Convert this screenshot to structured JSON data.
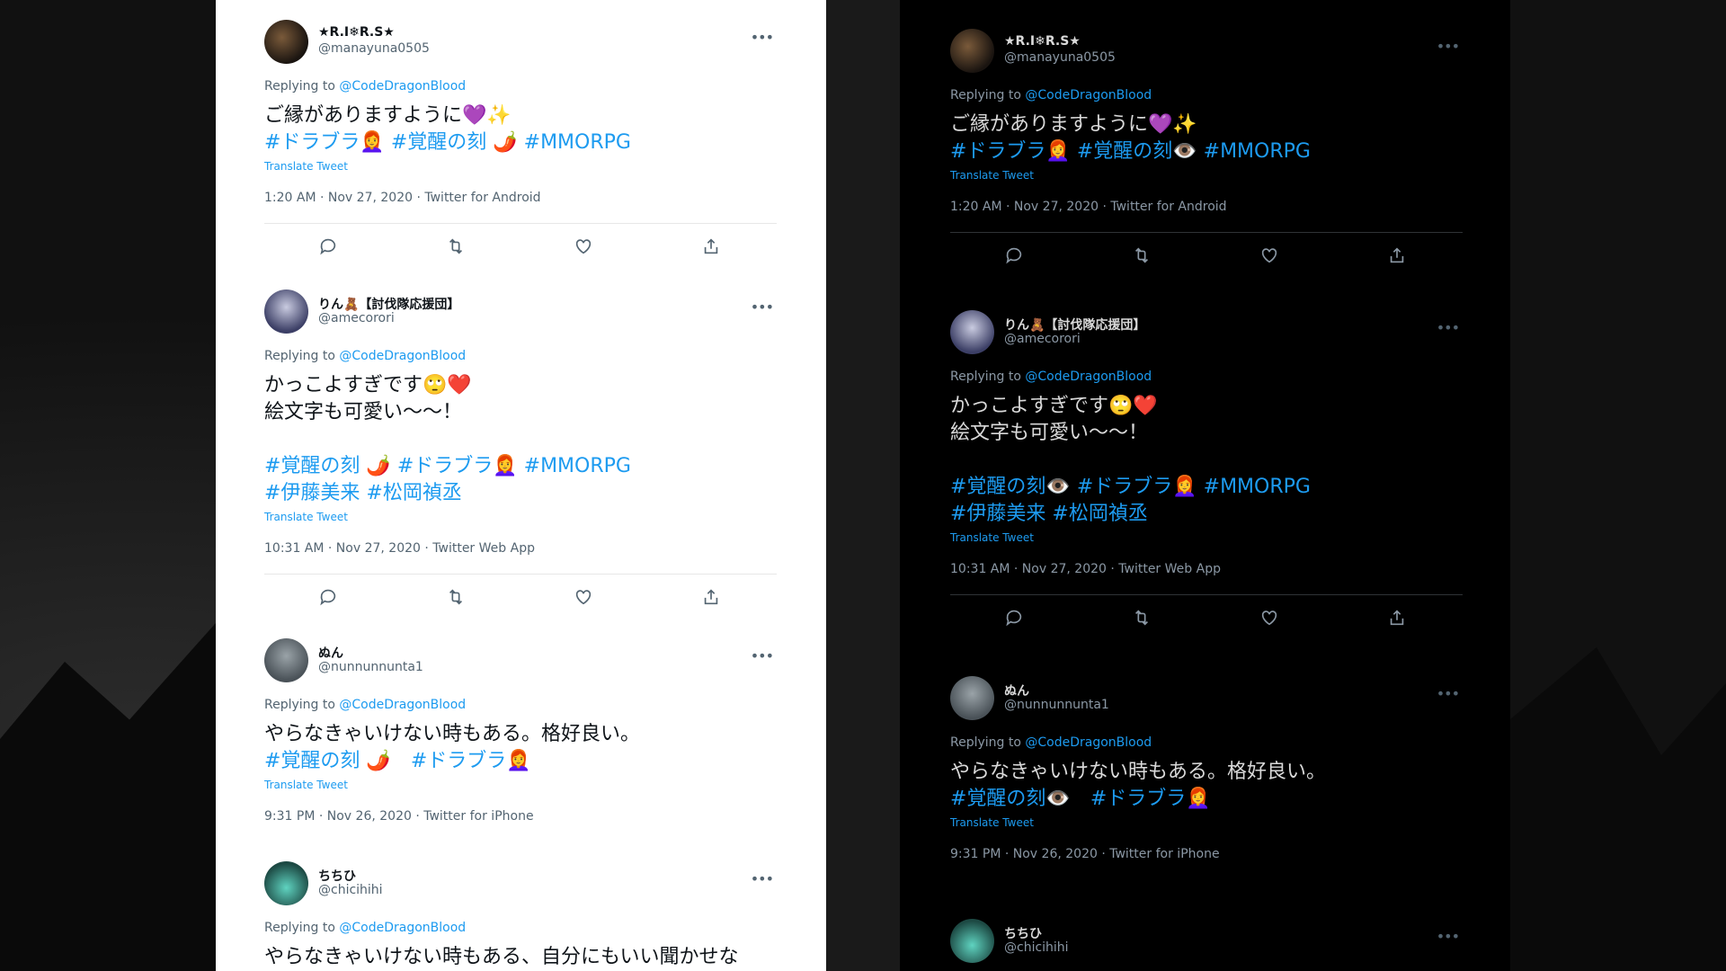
{
  "tweets": [
    {
      "name": "★R.I❄R.S★",
      "handle": "@manayuna0505",
      "replying_prefix": "Replying to ",
      "replying_to": "@CodeDragonBlood",
      "body": "ご縁がありますように💜✨",
      "hashtags": [
        "#ドラブラ👩‍🦰 #覚醒の刻 🌶️ #MMORPG"
      ],
      "translate": "Translate Tweet",
      "meta": "1:20 AM · Nov 27, 2020 · Twitter for Android"
    },
    {
      "name": "りん🧸【討伐隊応援団】",
      "handle": "@amecorori",
      "replying_prefix": "Replying to ",
      "replying_to": "@CodeDragonBlood",
      "body": "かっこよすぎです🙄❤️\n絵文字も可愛い〜〜！",
      "hashtags": [
        "#覚醒の刻 🌶️ #ドラブラ👩‍🦰 #MMORPG",
        "#伊藤美来 #松岡禎丞"
      ],
      "translate": "Translate Tweet",
      "meta": "10:31 AM · Nov 27, 2020 · Twitter Web App"
    },
    {
      "name": "ぬん",
      "handle": "@nunnunnunta1",
      "replying_prefix": "Replying to ",
      "replying_to": "@CodeDragonBlood",
      "body": "やらなきゃいけない時もある。格好良い。",
      "hashtags": [
        "#覚醒の刻 🌶️　#ドラブラ👩‍🦰"
      ],
      "translate": "Translate Tweet",
      "meta": "9:31 PM · Nov 26, 2020 · Twitter for iPhone"
    },
    {
      "name": "ちちひ",
      "handle": "@chicihihi",
      "replying_prefix": "Replying to ",
      "replying_to": "@CodeDragonBlood",
      "body": "やらなきゃいけない時もある、自分にもいい聞かせな"
    }
  ],
  "dark_tweets": [
    {
      "name": "★R.I❄R.S★",
      "handle": "@manayuna0505",
      "replying_prefix": "Replying to ",
      "replying_to": "@CodeDragonBlood",
      "body": "ご縁がありますように💜✨",
      "hashtags": [
        "#ドラブラ👩‍🦰 #覚醒の刻👁️ #MMORPG"
      ],
      "translate": "Translate Tweet",
      "meta": "1:20 AM · Nov 27, 2020 · Twitter for Android"
    },
    {
      "name": "りん🧸【討伐隊応援団】",
      "handle": "@amecorori",
      "replying_prefix": "Replying to ",
      "replying_to": "@CodeDragonBlood",
      "body": "かっこよすぎです🙄❤️\n絵文字も可愛い〜〜！",
      "hashtags": [
        "#覚醒の刻👁️ #ドラブラ👩‍🦰 #MMORPG",
        "#伊藤美来 #松岡禎丞"
      ],
      "translate": "Translate Tweet",
      "meta": "10:31 AM · Nov 27, 2020 · Twitter Web App"
    },
    {
      "name": "ぬん",
      "handle": "@nunnunnunta1",
      "replying_prefix": "Replying to ",
      "replying_to": "@CodeDragonBlood",
      "body": "やらなきゃいけない時もある。格好良い。",
      "hashtags": [
        "#覚醒の刻👁️　#ドラブラ👩‍🦰"
      ],
      "translate": "Translate Tweet",
      "meta": "9:31 PM · Nov 26, 2020 · Twitter for iPhone"
    },
    {
      "name": "ちちひ",
      "handle": "@chicihihi"
    }
  ],
  "icons": {
    "more": "more-icon",
    "reply": "reply-icon",
    "retweet": "retweet-icon",
    "like": "like-icon",
    "share": "share-icon"
  },
  "colors": {
    "link": "#1d9bf0",
    "light_bg": "#ffffff",
    "dark_bg": "#000000"
  }
}
